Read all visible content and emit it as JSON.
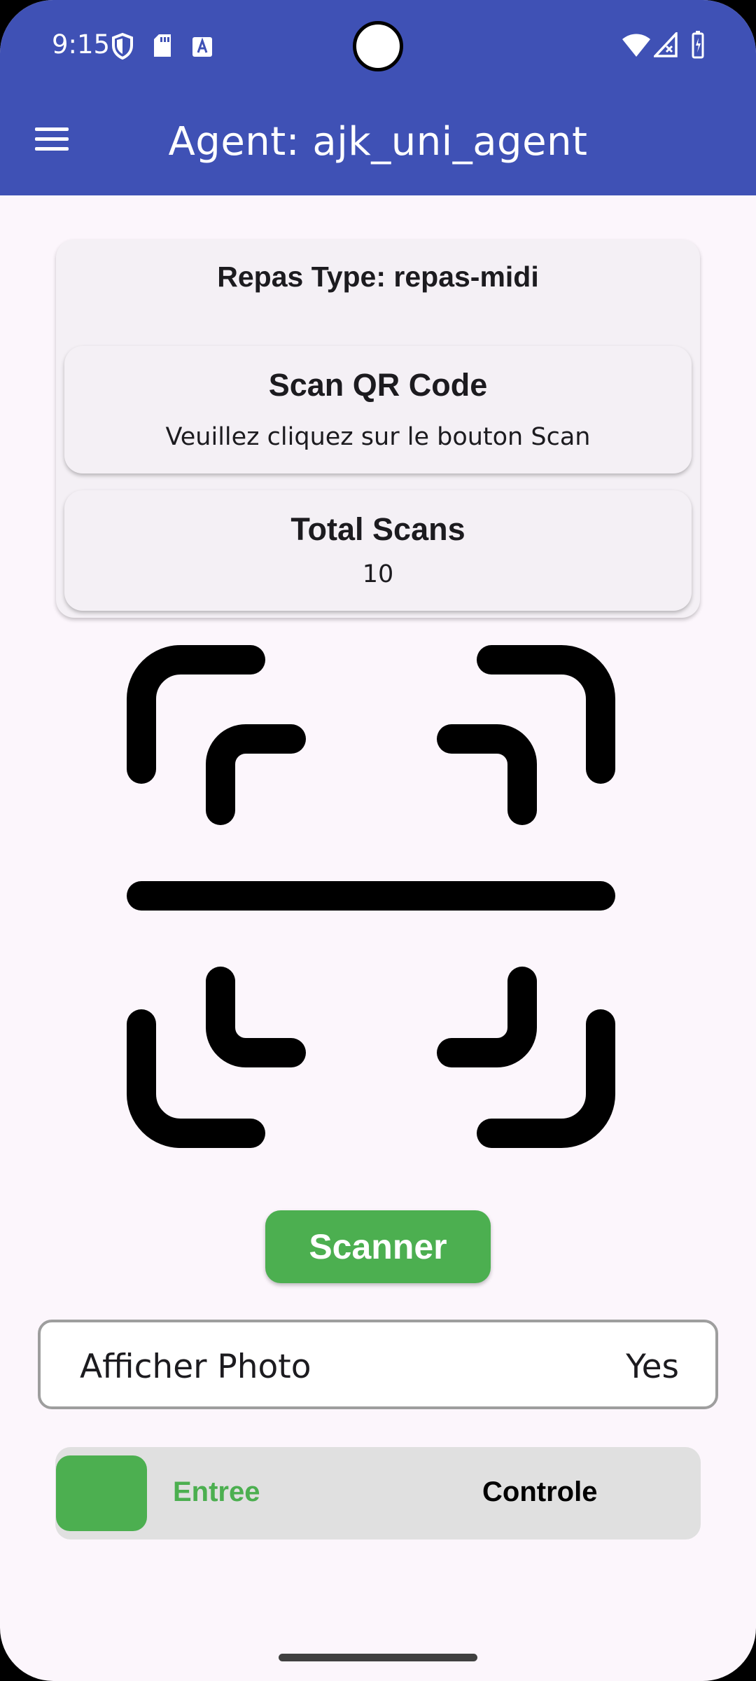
{
  "status_bar": {
    "time": "9:15",
    "icons_left": [
      "shield-icon",
      "sd-card-icon",
      "font-a-icon"
    ],
    "icons_right": [
      "wifi-icon",
      "signal-icon",
      "charging-icon"
    ]
  },
  "app_bar": {
    "title": "Agent: ajk_uni_agent",
    "background": "#3f51b5"
  },
  "info": {
    "repas_type": "Repas Type: repas-midi",
    "scan_title": "Scan QR Code",
    "scan_hint": "Veuillez cliquez sur le bouton Scan",
    "total_title": "Total Scans",
    "total_value": "10"
  },
  "scanner": {
    "icon": "qr-scanner-icon",
    "button_label": "Scanner",
    "button_color": "#4caf50"
  },
  "photo": {
    "label": "Afficher Photo",
    "value": "Yes"
  },
  "mode_toggle": {
    "option_left": "Entree",
    "option_right": "Controle",
    "selected": "Entree",
    "active_color": "#4caf50"
  }
}
